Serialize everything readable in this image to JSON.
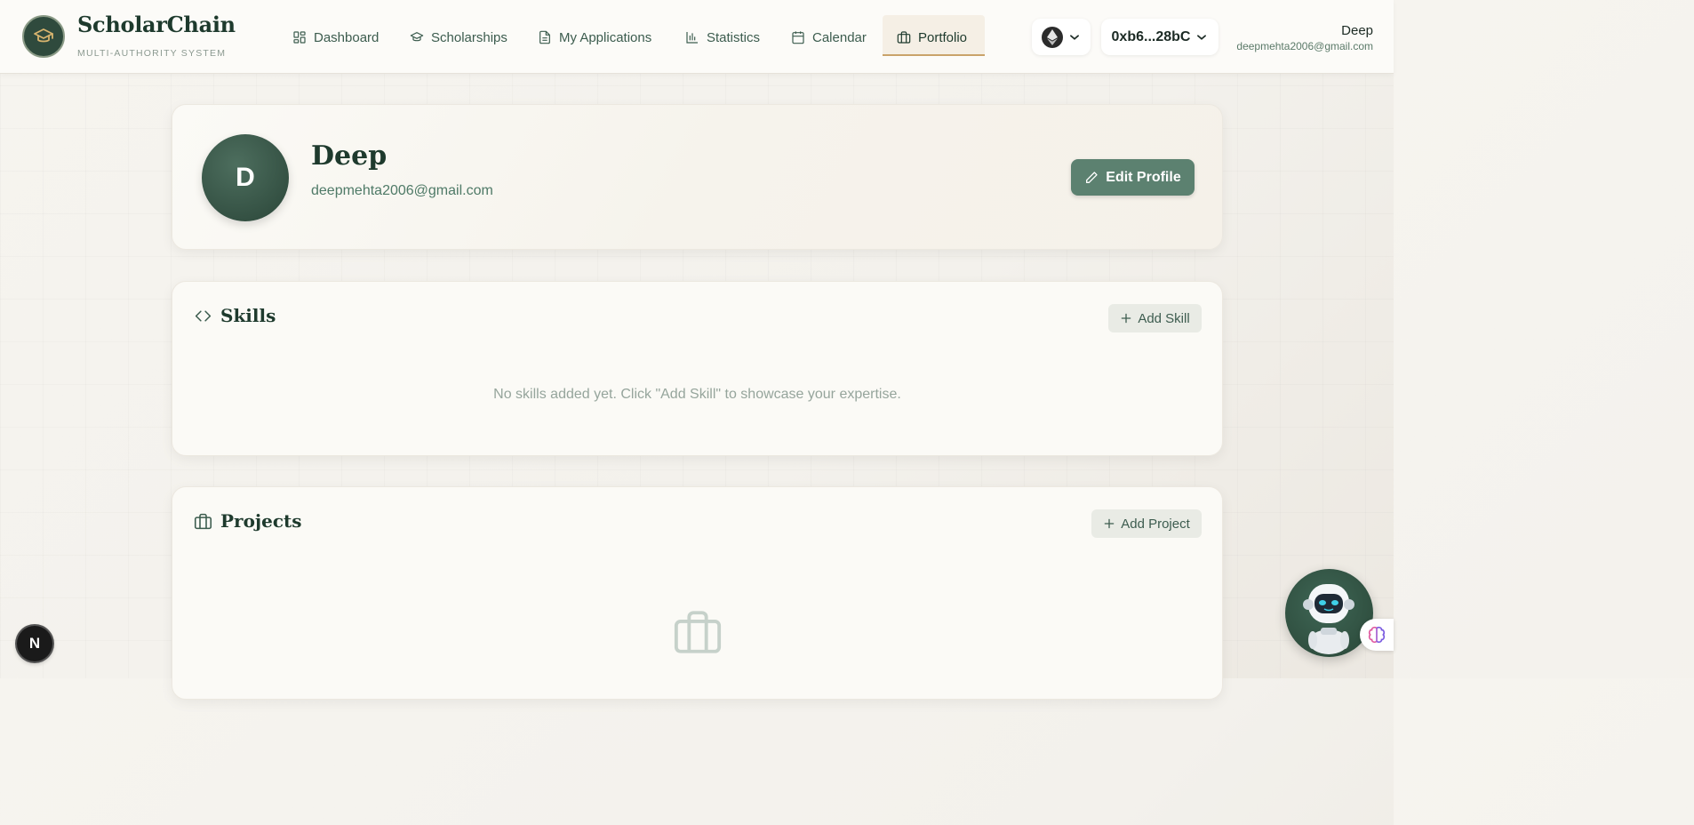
{
  "app": {
    "brand_name": "ScholarChain",
    "brand_subtitle": "MULTI-AUTHORITY SYSTEM"
  },
  "nav": {
    "items": [
      {
        "label": "Dashboard",
        "icon": "grid-icon"
      },
      {
        "label": "Scholarships",
        "icon": "graduation-cap-icon"
      },
      {
        "label": "My Applications",
        "icon": "document-icon"
      },
      {
        "label": "Statistics",
        "icon": "bar-chart-icon"
      },
      {
        "label": "Calendar",
        "icon": "calendar-icon"
      },
      {
        "label": "Portfolio",
        "icon": "briefcase-icon",
        "active": true
      }
    ]
  },
  "wallet": {
    "network_icon": "ethereum-icon",
    "address": "0xb6...28bC"
  },
  "user": {
    "name": "Deep",
    "email": "deepmehta2006@gmail.com"
  },
  "profile": {
    "initial": "D",
    "name": "Deep",
    "email": "deepmehta2006@gmail.com",
    "edit_label": "Edit Profile"
  },
  "skills": {
    "title": "Skills",
    "add_label": "Add Skill",
    "empty_text": "No skills added yet. Click \"Add Skill\" to showcase your expertise."
  },
  "projects": {
    "title": "Projects",
    "add_label": "Add Project"
  },
  "floating": {
    "next_badge": "N"
  },
  "colors": {
    "primary": "#2f4a3d",
    "accent": "#c9a36a",
    "button": "#5c8170"
  }
}
